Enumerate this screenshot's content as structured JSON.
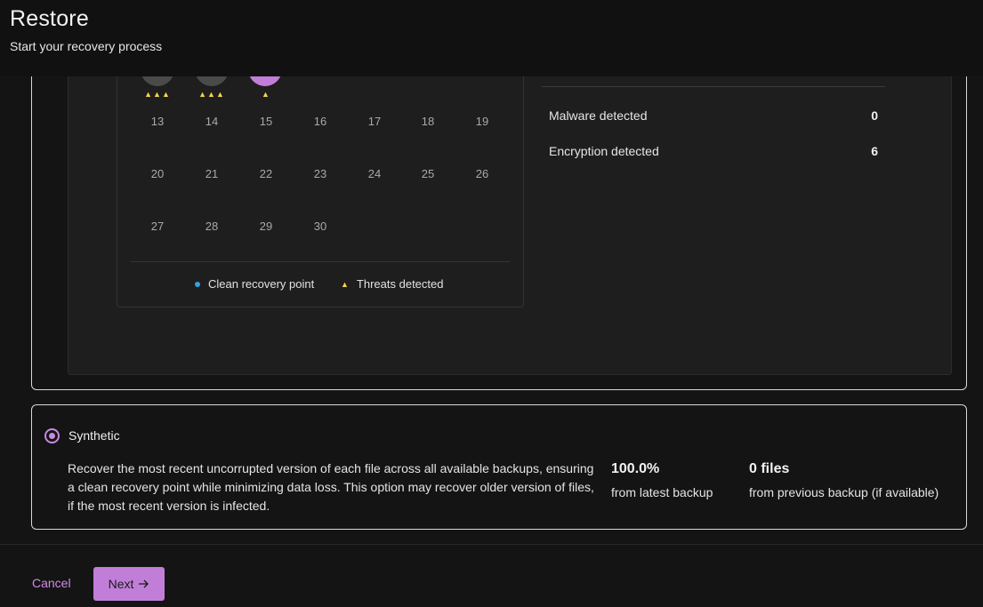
{
  "header": {
    "title": "Restore",
    "subtitle": "Start your recovery process"
  },
  "calendar": {
    "top_row_markers": [
      {
        "day": "",
        "color": "#4a4a4a",
        "threats": "▲▲▲"
      },
      {
        "day": "",
        "color": "#4a4a4a",
        "threats": "▲▲▲"
      },
      {
        "day": "",
        "color": "#c17ed8",
        "threats": "▲"
      }
    ],
    "weeks": [
      [
        "13",
        "14",
        "15",
        "16",
        "17",
        "18",
        "19"
      ],
      [
        "20",
        "21",
        "22",
        "23",
        "24",
        "25",
        "26"
      ],
      [
        "27",
        "28",
        "29",
        "30"
      ]
    ],
    "legend": {
      "clean": "Clean recovery point",
      "threats": "Threats detected"
    }
  },
  "scan_summary": {
    "rows": [
      {
        "label": "Malware detected",
        "value": "0"
      },
      {
        "label": "Encryption detected",
        "value": "6"
      }
    ]
  },
  "synthetic": {
    "label": "Synthetic",
    "description": "Recover the most recent uncorrupted version of each file across all available backups, ensuring a clean recovery point while minimizing data loss. This option may recover older version of files, if the most recent version is infected.",
    "latest_value": "100.0%",
    "latest_caption": "from latest backup",
    "previous_value": "0 files",
    "previous_caption": "from previous backup (if available)"
  },
  "footer": {
    "cancel_label": "Cancel",
    "next_label": "Next",
    "next_icon": "arrow-right-icon"
  },
  "colors": {
    "accent": "#c17ed8",
    "threat": "#f5d547",
    "clean": "#3aa0e0"
  }
}
